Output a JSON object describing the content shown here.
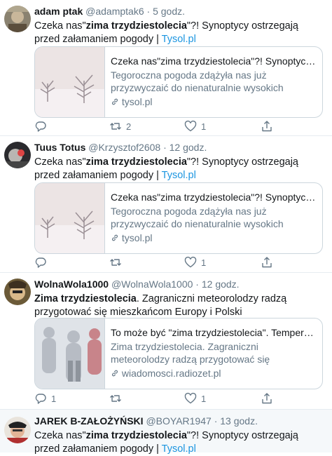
{
  "tweets": [
    {
      "name": "adam ptak",
      "handle": "@adamptak6",
      "sep": "·",
      "time": "5 godz.",
      "text_before": "Czeka nas\"",
      "text_bold": "zima trzydziestolecia",
      "text_after": "\"?! Synoptycy ostrzegają przed załamaniem pogody | ",
      "link": "Tysol.pl",
      "card": {
        "title": "Czeka nas\"zima trzydziestolecia\"?! Synoptycy ostrzegają przed załamaniem pogody",
        "desc": "Tegoroczna pogoda zdążyła nas już przyzwyczaić do nienaturalnie wysokich temperatur. Jesień w tym rok...",
        "domain": "tysol.pl"
      },
      "retweets": "2",
      "likes": "1",
      "replies": ""
    },
    {
      "name": "Tuus Totus",
      "handle": "@Krzysztof2608",
      "sep": "·",
      "time": "12 godz.",
      "text_before": "Czeka nas\"",
      "text_bold": "zima trzydziestolecia",
      "text_after": "\"?! Synoptycy ostrzegają przed załamaniem pogody | ",
      "link": "Tysol.pl",
      "card": {
        "title": "Czeka nas\"zima trzydziestolecia\"?! Synoptycy ostrzegają przed załamaniem pogody",
        "desc": "Tegoroczna pogoda zdążyła nas już przyzwyczaić do nienaturalnie wysokich temperatur. Jesień w tym rok...",
        "domain": "tysol.pl"
      },
      "retweets": "",
      "likes": "1",
      "replies": ""
    },
    {
      "name": "WolnaWola1000",
      "handle": "@WolnaWola1000",
      "sep": "·",
      "time": "12 godz.",
      "text_bold": "Zima trzydziestolecia",
      "text_after": ". Zagraniczni meteorolodzy radzą przygotować się mieszkańcom Europy i Polski",
      "card": {
        "title": "To może być \"zima trzydziestolecia\". Temperatury spadną",
        "desc": "Zima trzydziestolecia. Zagraniczni meteorolodzy radzą przygotować się mieszkańcom Europy i Polski na...",
        "domain": "wiadomosci.radiozet.pl"
      },
      "replies": "1",
      "retweets": "",
      "likes": "1"
    },
    {
      "name": "JAREK B-ZAŁOŻYŃSKI",
      "handle": "@BOYAR1947",
      "sep": "·",
      "time": "13 godz.",
      "text_before": "Czeka nas\"",
      "text_bold": "zima trzydziestolecia",
      "text_after": "\"?! Synoptycy ostrzegają przed załamaniem pogody | ",
      "link": "Tysol.pl"
    }
  ],
  "icons": {
    "reply": "reply-icon",
    "retweet": "retweet-icon",
    "like": "heart-icon",
    "share": "share-icon",
    "link": "link-icon"
  },
  "colors": {
    "link": "#1b95e0",
    "muted": "#657786",
    "border": "#ccd6dd"
  }
}
